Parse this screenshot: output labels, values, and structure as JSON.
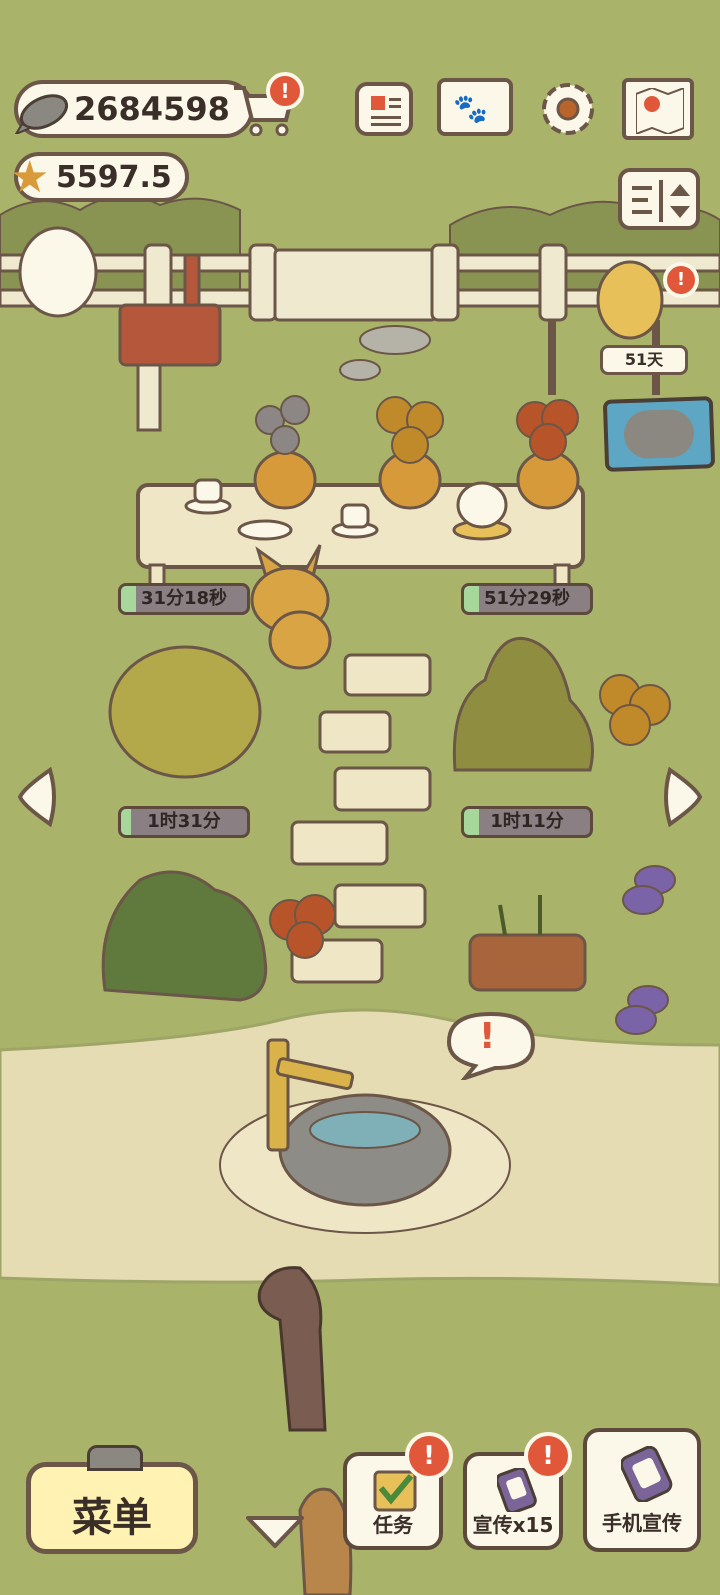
{
  "currency": {
    "fish_amount": "2684598",
    "star_amount": "5597.5"
  },
  "top_icons": {
    "newspaper": "newspaper-icon",
    "album": "paw-album-icon",
    "settings": "gear-icon",
    "map": "map-icon",
    "sort": "sort-icon"
  },
  "badges": {
    "shop": "!",
    "visitor": "!",
    "task": "!",
    "promote": "!"
  },
  "visitor_days": "51天",
  "timers": {
    "table_left": "31分18秒",
    "table_right": "51分29秒",
    "bush_left": "1时31分",
    "bush_right": "1时11分"
  },
  "speech_bubble": "!",
  "bottom_bar": {
    "menu_label": "菜单",
    "task_label": "任务",
    "promote_label": "宣传x15",
    "phone_promote_label": "手机宣传"
  },
  "colors": {
    "grass": "#a9b46a",
    "path": "#e6dcb4",
    "outline": "#6b5648",
    "badge": "#e0573a",
    "timer_fill": "#a7d79a"
  }
}
